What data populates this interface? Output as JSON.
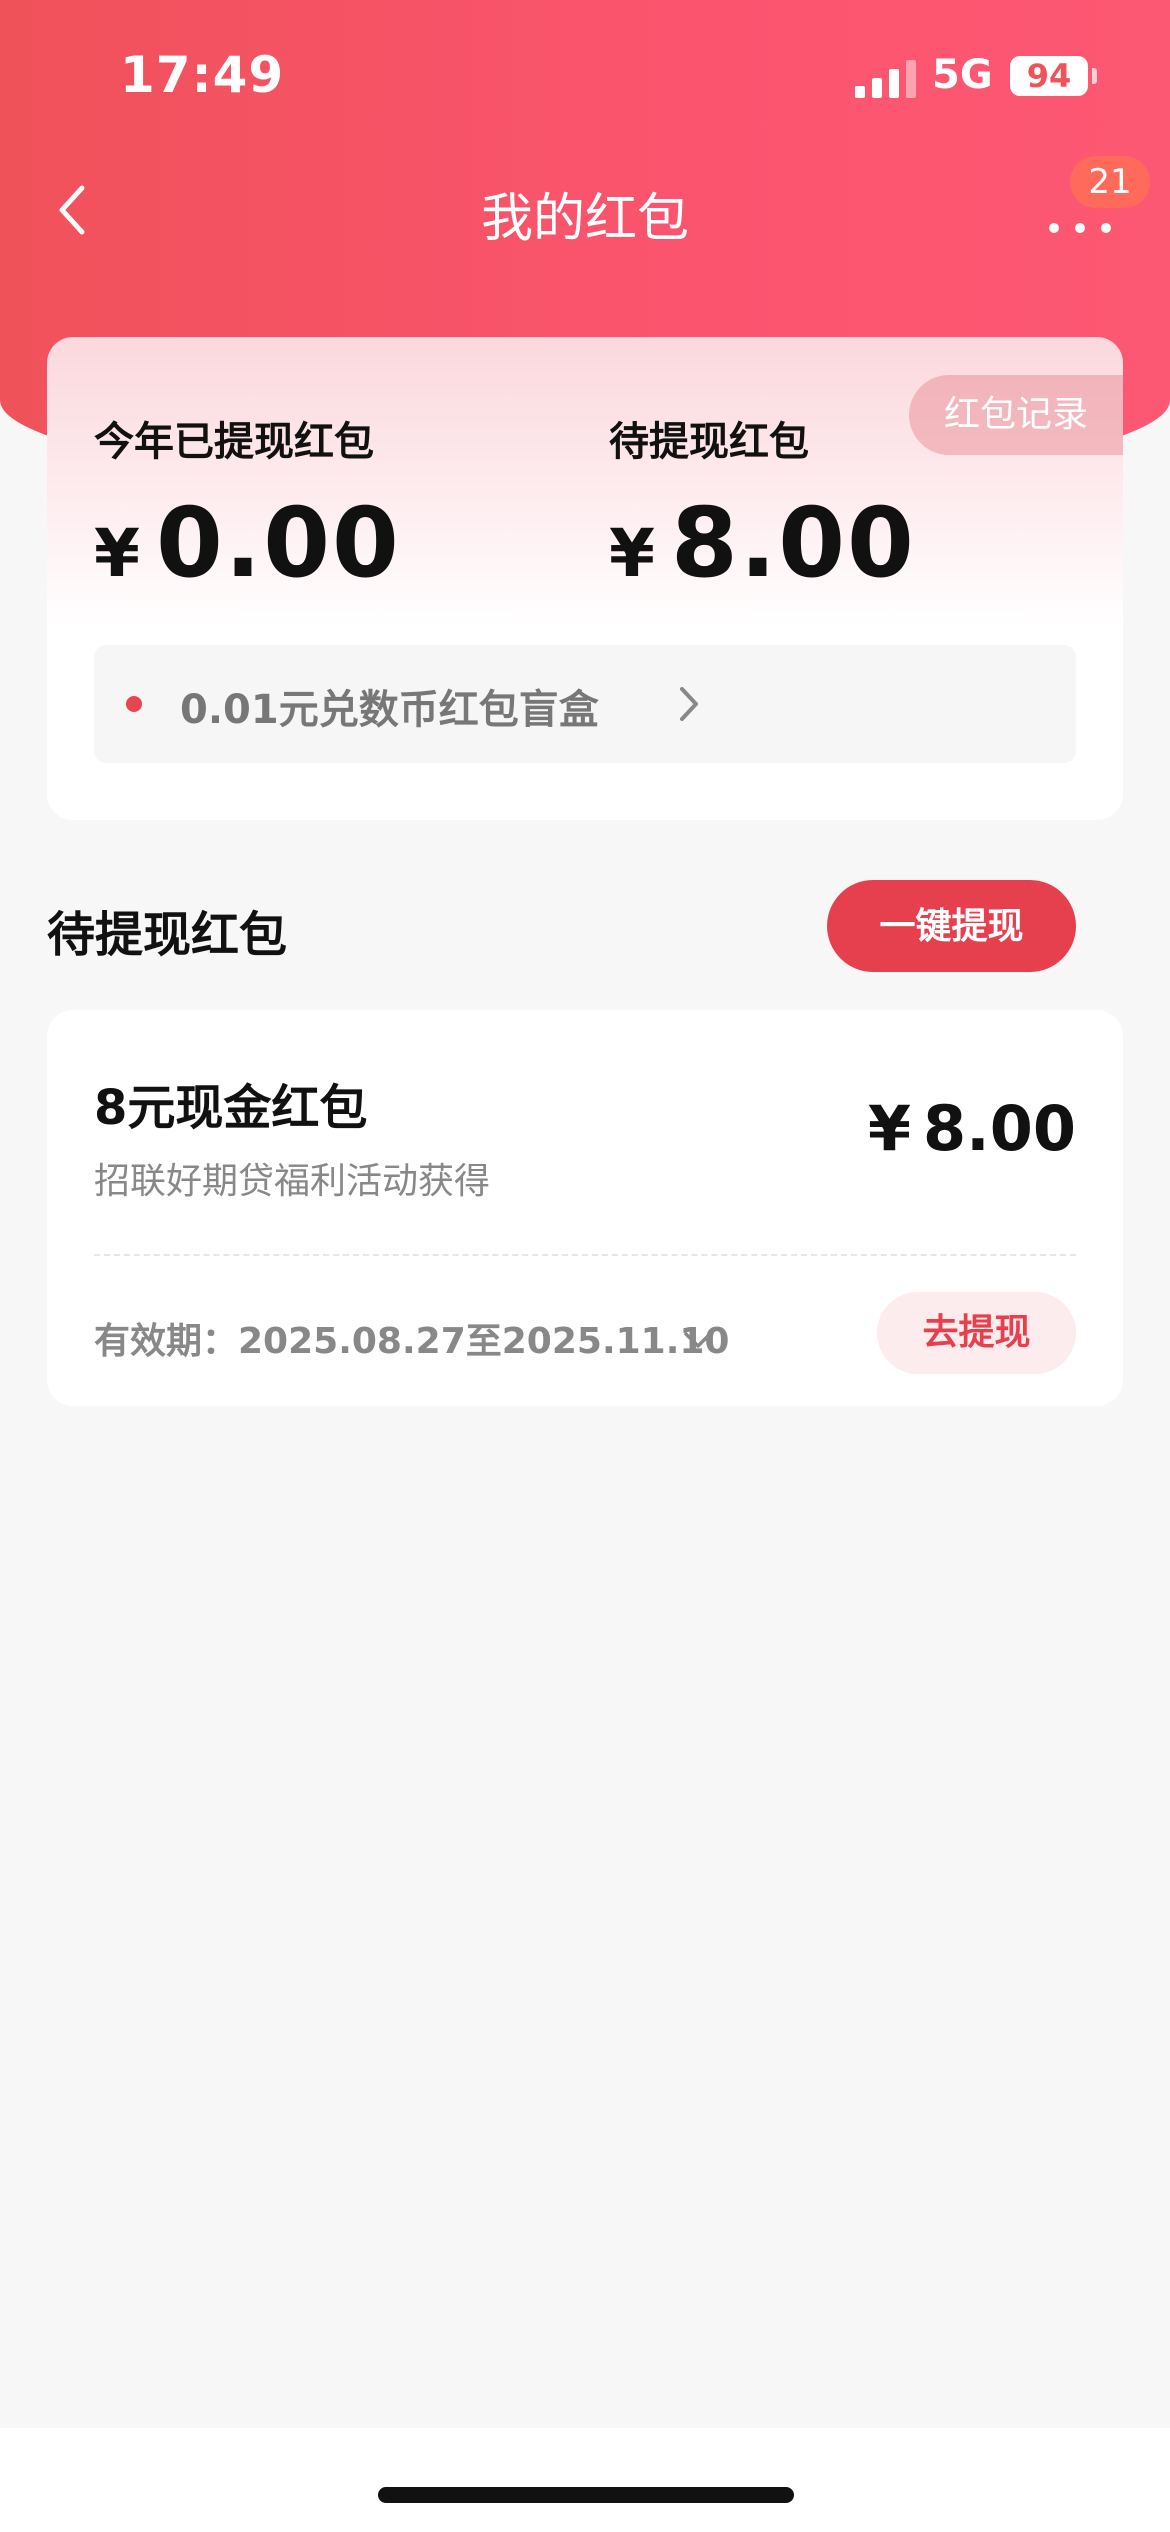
{
  "status_bar": {
    "time": "17:49",
    "network": "5G",
    "battery": "94",
    "icons": [
      "signal-icon",
      "battery-icon"
    ]
  },
  "nav": {
    "title": "我的红包",
    "badge": "21",
    "icons": [
      "back-chevron-icon",
      "more-icon"
    ]
  },
  "summary": {
    "record_label": "红包记录",
    "withdrawn_label": "今年已提现红包",
    "withdrawn_currency": "¥",
    "withdrawn_amount": "0.00",
    "pending_label": "待提现红包",
    "pending_currency": "¥",
    "pending_amount": "8.00",
    "blind_box_text": "0.01元兑数币红包盲盒"
  },
  "section": {
    "title": "待提现红包",
    "withdraw_all_label": "一键提现"
  },
  "packets": [
    {
      "title": "8元现金红包",
      "subtitle": "招联好期贷福利活动获得",
      "currency": "¥",
      "amount": "8.00",
      "validity": "有效期：2025.08.27至2025.11.10",
      "action_label": "去提现"
    }
  ],
  "colors": {
    "brand_red": "#e6404f",
    "header_gradient_start": "#f0525a",
    "header_gradient_end": "#fd5873"
  }
}
